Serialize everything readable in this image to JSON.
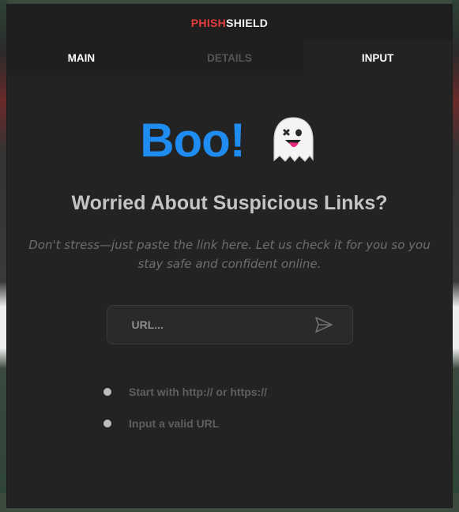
{
  "brand": {
    "part1": "PHISH",
    "part2": "SHIELD",
    "color1": "#e63b3b",
    "color2": "#f2f2f2"
  },
  "tabs": [
    {
      "label": "MAIN",
      "state": "normal"
    },
    {
      "label": "DETAILS",
      "state": "disabled"
    },
    {
      "label": "INPUT",
      "state": "active"
    }
  ],
  "hero": {
    "title": "Boo!",
    "icon": "ghost-icon",
    "title_color": "#1e8cf0"
  },
  "headline": "Worried About Suspicious Links?",
  "subtext": "Don't stress—just paste the link here. Let us check it for you so you stay safe and confident online.",
  "url_input": {
    "placeholder": "URL...",
    "value": "",
    "send_icon": "send-icon"
  },
  "checks": [
    {
      "text": "Start with http:// or https://"
    },
    {
      "text": "Input a valid URL"
    }
  ]
}
